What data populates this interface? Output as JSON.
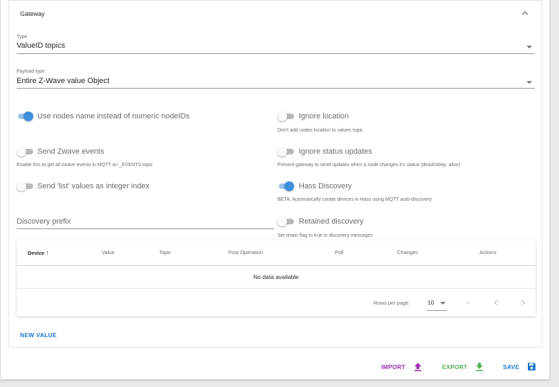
{
  "panel": {
    "title": "Gateway"
  },
  "type_field": {
    "label": "Type",
    "value": "ValueID topics"
  },
  "payload_field": {
    "label": "Payload type",
    "value": "Entire Z-Wave value Object"
  },
  "toggles": {
    "use_nodes_name": {
      "label": "Use nodes name instead of numeric nodeIDs",
      "hint": "",
      "checked": true
    },
    "ignore_location": {
      "label": "Ignore location",
      "hint": "Don't add nodes location to values topic",
      "checked": false
    },
    "send_zwave_events": {
      "label": "Send Zwave events",
      "hint": "Enable this to get all zwave events in MQTT on _EVENTS topic",
      "checked": false
    },
    "ignore_status": {
      "label": "Ignore status updates",
      "hint": "Prevent gateway to send updates when a node changes it's status (dead/sleep, alive)",
      "checked": false
    },
    "send_list_int": {
      "label": "Send 'list' values as integer index",
      "hint": "",
      "checked": false
    },
    "hass_discovery": {
      "label": "Hass Discovery",
      "hint": "BETA: Automatically create devices in Hass using MQTT auto-discovery",
      "checked": true
    },
    "retained_discovery": {
      "label": "Retained discovery",
      "hint": "Set retain flag to true in discovery messages",
      "checked": false
    }
  },
  "discovery_prefix": {
    "placeholder": "Discovery prefix"
  },
  "table": {
    "headers": [
      "Device",
      "Value",
      "Topic",
      "Post Operation",
      "Poll",
      "Changes",
      "Actions"
    ],
    "sort_arrow": "↑",
    "empty_text": "No data available",
    "rows_per_page_label": "Rows per page:",
    "rows_per_page_value": "10",
    "page_info": "–"
  },
  "buttons": {
    "new_value": "NEW VALUE",
    "import": "IMPORT",
    "export": "EXPORT",
    "save": "SAVE"
  },
  "colors": {
    "primary": "#1976d2",
    "switch_on": "#3f8ee0",
    "import": "#9c27b0",
    "export": "#4caf50",
    "save": "#1976d2"
  },
  "icons": {
    "collapse": "chevron-up-icon",
    "caret": "menu-down-icon",
    "import": "upload-icon",
    "export": "download-icon",
    "save": "floppy-icon",
    "prev": "chevron-left-icon",
    "next": "chevron-right-icon"
  }
}
